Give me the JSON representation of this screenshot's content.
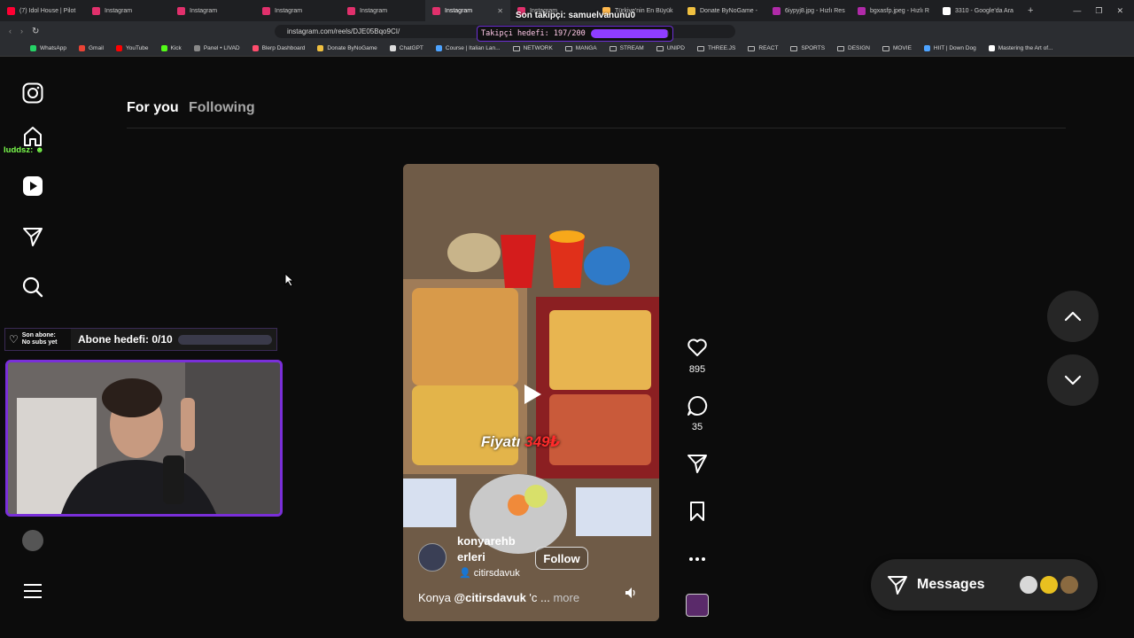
{
  "browser": {
    "tabs": [
      {
        "title": "(7) Idol House | Pilot",
        "color": "#ff0033",
        "active": false
      },
      {
        "title": "Instagram",
        "color": "#e1306c",
        "active": false
      },
      {
        "title": "Instagram",
        "color": "#e1306c",
        "active": false
      },
      {
        "title": "Instagram",
        "color": "#e1306c",
        "active": false
      },
      {
        "title": "Instagram",
        "color": "#e1306c",
        "active": false
      },
      {
        "title": "Instagram",
        "color": "#e1306c",
        "active": true
      },
      {
        "title": "Instagram",
        "color": "#e1306c",
        "active": false
      },
      {
        "title": "Türkiye'nin En Büyük",
        "color": "#ffb84d",
        "active": false
      },
      {
        "title": "Donate ByNoGame -",
        "color": "#f0c040",
        "active": false
      },
      {
        "title": "6iypyj8.jpg - Hızlı Res",
        "color": "#b02aa8",
        "active": false
      },
      {
        "title": "bgxasfp.jpeg - Hızlı R",
        "color": "#b02aa8",
        "active": false
      },
      {
        "title": "3310 - Google'da Ara",
        "color": "#ffffff",
        "active": false
      }
    ],
    "url": "instagram.com/reels/DJE05Bqo9CI/",
    "bookmarks": [
      {
        "label": "WhatsApp",
        "type": "site",
        "color": "#25d366"
      },
      {
        "label": "Gmail",
        "type": "site",
        "color": "#ea4335"
      },
      {
        "label": "YouTube",
        "type": "site",
        "color": "#ff0000"
      },
      {
        "label": "Kick",
        "type": "site",
        "color": "#53fc18"
      },
      {
        "label": "Panel • LIVAD",
        "type": "site",
        "color": "#888888"
      },
      {
        "label": "Blerp Dashboard",
        "type": "site",
        "color": "#ff4d6d"
      },
      {
        "label": "Donate ByNoGame",
        "type": "site",
        "color": "#f0c040"
      },
      {
        "label": "ChatGPT",
        "type": "site",
        "color": "#dddddd"
      },
      {
        "label": "Course | Italian Lan...",
        "type": "site",
        "color": "#4da3ff"
      },
      {
        "label": "NETWORK",
        "type": "folder"
      },
      {
        "label": "MANGA",
        "type": "folder"
      },
      {
        "label": "STREAM",
        "type": "folder"
      },
      {
        "label": "UNIPD",
        "type": "folder"
      },
      {
        "label": "THREE.JS",
        "type": "folder"
      },
      {
        "label": "REACT",
        "type": "folder"
      },
      {
        "label": "SPORTS",
        "type": "folder"
      },
      {
        "label": "DESIGN",
        "type": "folder"
      },
      {
        "label": "MOVIE",
        "type": "folder"
      },
      {
        "label": "HIIT | Down Dog",
        "type": "site",
        "color": "#4da3ff"
      },
      {
        "label": "Mastering the Art of...",
        "type": "site",
        "color": "#ffffff"
      }
    ]
  },
  "overlay": {
    "last_follower": "Son takipçi: samuelvanunu0",
    "follower_goal": "Takipçi hedefi: 197/200",
    "follower_goal_fraction": 0.985,
    "chat_user": "luddsz:",
    "last_sub_line1": "Son abone:",
    "last_sub_line2": "No subs yet",
    "sub_goal": "Abone hedefi: 0/10",
    "sub_goal_fraction": 0
  },
  "feed": {
    "tab_for_you": "For you",
    "tab_following": "Following"
  },
  "reel": {
    "price_label": "Fiyatı",
    "price_value": "349₺",
    "author_line1": "konyarehb",
    "author_line2": "erleri",
    "audio": "citirsdavuk",
    "follow_label": "Follow",
    "caption_prefix": "Konya ",
    "caption_tag": "@citirsdavuk",
    "caption_rest": " 'c ... ",
    "caption_more": "more",
    "likes": "895",
    "comments": "35"
  },
  "messages": {
    "label": "Messages"
  },
  "colors": {
    "accent_purple": "#7a2fd9",
    "chat_green": "#7cff4d",
    "price_red": "#ff2b2b"
  }
}
